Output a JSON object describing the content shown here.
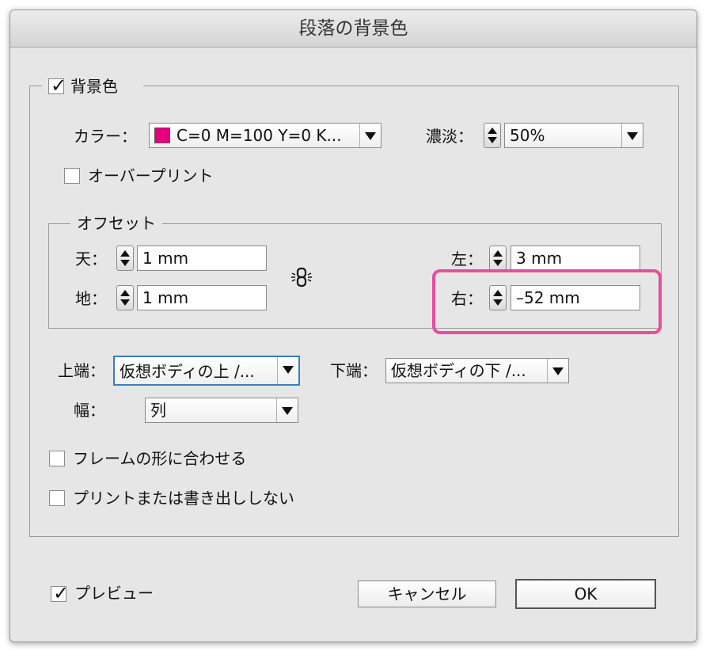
{
  "dialog": {
    "title": "段落の背景色"
  },
  "background_group": {
    "checkbox_label": "背景色",
    "checked": true,
    "color_label": "カラー：",
    "color_value": "C=0 M=100 Y=0 K...",
    "swatch_color": "#e6007e",
    "tint_label": "濃淡：",
    "tint_value": "50%",
    "overprint_label": "オーバープリント",
    "overprint_checked": false
  },
  "offset_group": {
    "legend": "オフセット",
    "top_label": "天：",
    "top_value": "1 mm",
    "bottom_label": "地：",
    "bottom_value": "1 mm",
    "left_label": "左：",
    "left_value": "3 mm",
    "right_label": "右：",
    "right_value": "–52 mm",
    "highlight_color": "#e64e9f"
  },
  "edges": {
    "top_edge_label": "上端：",
    "top_edge_value": "仮想ボディの上 /...",
    "bottom_edge_label": "下端：",
    "bottom_edge_value": "仮想ボディの下 /...",
    "width_label": "幅：",
    "width_value": "列"
  },
  "options": {
    "fit_frame_label": "フレームの形に合わせる",
    "fit_frame_checked": false,
    "no_print_label": "プリントまたは書き出ししない",
    "no_print_checked": false
  },
  "footer": {
    "preview_label": "プレビュー",
    "preview_checked": true,
    "cancel_label": "キャンセル",
    "ok_label": "OK"
  }
}
